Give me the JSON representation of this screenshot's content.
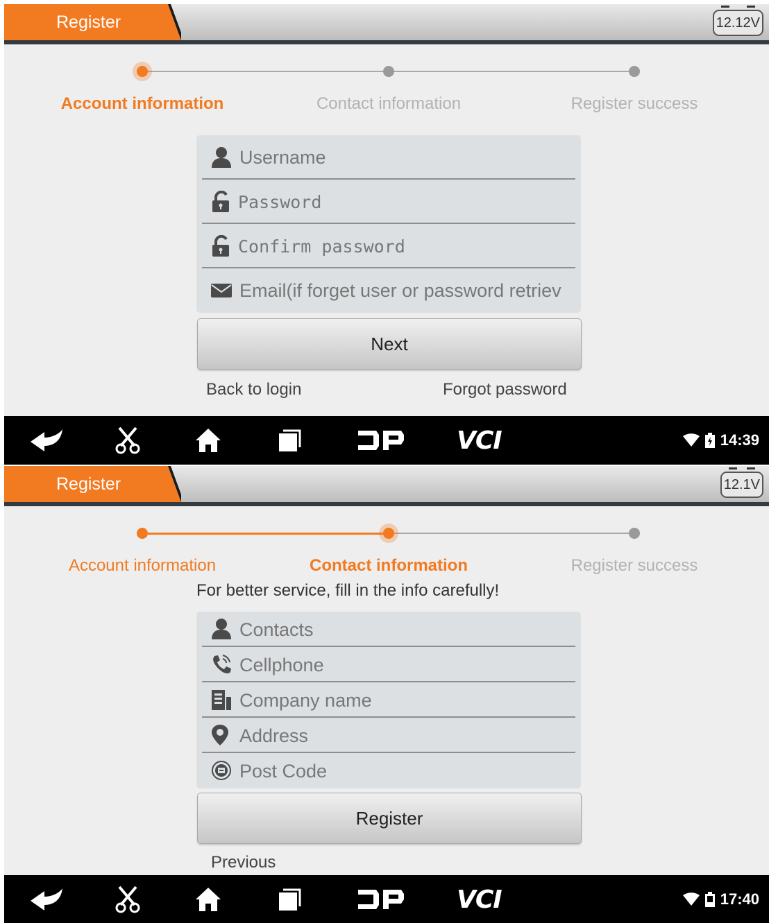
{
  "screen1": {
    "title": "Register",
    "voltage": "12.12V",
    "steps": [
      "Account information",
      "Contact information",
      "Register success"
    ],
    "fields": {
      "username_placeholder": "Username",
      "password_placeholder": "Password",
      "confirm_placeholder": "Confirm password",
      "email_placeholder": "Email(if forget user or password retriev"
    },
    "next_label": "Next",
    "back_to_login": "Back to login",
    "forgot_password": "Forgot password",
    "clock": "14:39"
  },
  "screen2": {
    "title": "Register",
    "voltage": "12.1V",
    "steps": [
      "Account information",
      "Contact information",
      "Register success"
    ],
    "hint": "For better service, fill in the info carefully!",
    "fields": {
      "contacts_placeholder": "Contacts",
      "cellphone_placeholder": "Cellphone",
      "company_placeholder": "Company name",
      "address_placeholder": "Address",
      "postcode_placeholder": "Post Code"
    },
    "register_label": "Register",
    "previous": "Previous",
    "clock": "17:40"
  },
  "navbar": {
    "vci_label": "VCI",
    "icons": [
      "back-icon",
      "scissors-icon",
      "home-icon",
      "recent-apps-icon",
      "dp-logo-icon",
      "vci-icon",
      "wifi-icon",
      "battery-icon"
    ]
  },
  "colors": {
    "accent": "#f27a20",
    "bar": "#000000",
    "panel": "#eeeeee"
  }
}
